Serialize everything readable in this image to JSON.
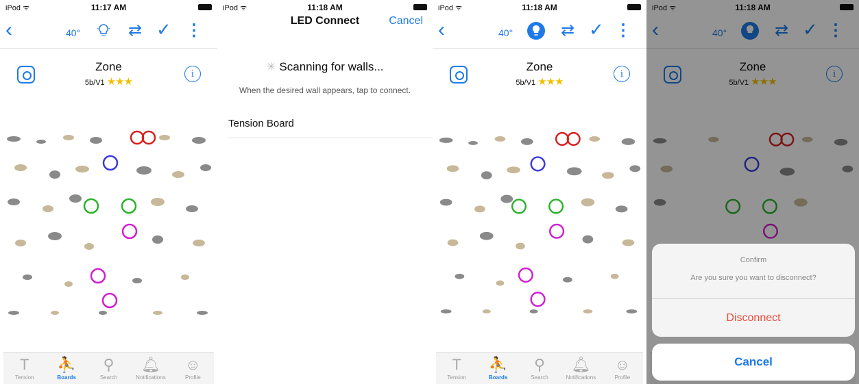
{
  "status1": {
    "carrier": "iPod ᯤ",
    "time": "11:17 AM"
  },
  "status2": {
    "carrier": "iPod ᯤ",
    "time": "11:18 AM"
  },
  "nav": {
    "back": "‹",
    "temp": "40°",
    "swap": "⇄",
    "check": "✓",
    "more": "⋮"
  },
  "problem": {
    "title": "Zone",
    "grade": "5b/V1",
    "stars": "★★★"
  },
  "led_connect": {
    "title": "LED Connect",
    "cancel": "Cancel",
    "scanning": "Scanning for walls...",
    "hint": "When the desired wall appears, tap to connect.",
    "wall": "Tension Board"
  },
  "tabs": [
    {
      "label": "Tension",
      "icon": "T"
    },
    {
      "label": "Boards",
      "icon": "⛹"
    },
    {
      "label": "Search",
      "icon": "⚲"
    },
    {
      "label": "Notifications",
      "icon": "🔔︎"
    },
    {
      "label": "Profile",
      "icon": "☺"
    }
  ],
  "confirm": {
    "title": "Confirm",
    "message": "Are you sure you want to disconnect?",
    "disconnect": "Disconnect",
    "cancel": "Cancel"
  },
  "colors": {
    "accent": "#1e7ae6",
    "danger": "#e74c3c",
    "star": "#f0c000"
  },
  "holds_markers": [
    "red-pair-top",
    "blue",
    "green-left",
    "green-right",
    "magenta-mid",
    "magenta-low",
    "magenta-bottom"
  ]
}
